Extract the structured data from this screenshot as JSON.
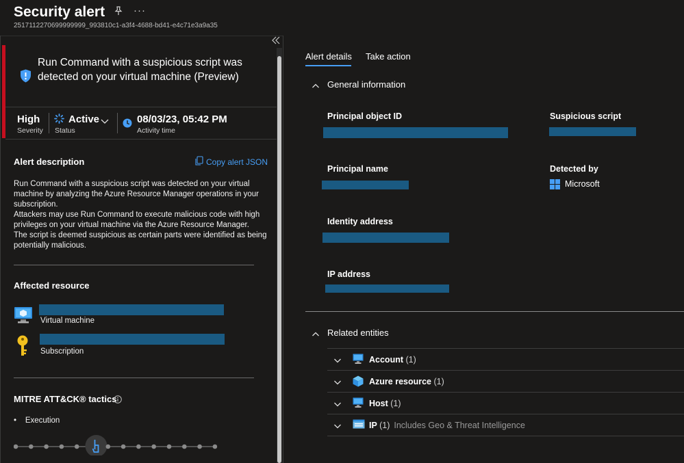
{
  "header": {
    "title": "Security alert",
    "alert_id": "2517112270699999999_993810c1-a3f4-4688-bd41-e4c71e3a9a35",
    "more_label": "···"
  },
  "alert": {
    "name": "Run Command with a suspicious script was detected on your virtual machine (Preview)",
    "severity_value": "High",
    "severity_label": "Severity",
    "status_value": "Active",
    "status_label": "Status",
    "activity_value": "08/03/23, 05:42 PM",
    "activity_label": "Activity time"
  },
  "description": {
    "title": "Alert description",
    "copy_label": "Copy alert JSON",
    "lines": [
      "Run Command with a suspicious script was detected on your virtual machine by analyzing the Azure Resource Manager operations in your subscription.",
      "Attackers may use Run Command to execute malicious code with high privileges on your virtual machine via the Azure Resource Manager.",
      "The script is deemed suspicious as certain parts were identified as being potentially malicious."
    ]
  },
  "affected": {
    "title": "Affected resource",
    "vm_label": "Virtual machine",
    "sub_label": "Subscription"
  },
  "mitre": {
    "title": "MITRE ATT&CK® tactics",
    "tactics": [
      "Execution"
    ],
    "kill_chain_active_index": 5
  },
  "tabs": {
    "details": "Alert details",
    "action": "Take action"
  },
  "general": {
    "title": "General information",
    "principal_object_id": "Principal object ID",
    "suspicious_script": "Suspicious script",
    "principal_name": "Principal name",
    "detected_by": "Detected by",
    "detected_by_value": "Microsoft",
    "identity_address": "Identity address",
    "ip_address": "IP address"
  },
  "related": {
    "title": "Related entities",
    "entities": [
      {
        "name": "Account",
        "count": "(1)",
        "note": "",
        "icon": "monitor-icon"
      },
      {
        "name": "Azure resource",
        "count": "(1)",
        "note": "",
        "icon": "cube-icon"
      },
      {
        "name": "Host",
        "count": "(1)",
        "note": "",
        "icon": "monitor-icon"
      },
      {
        "name": "IP",
        "count": "(1)",
        "note": "Includes Geo & Threat Intelligence",
        "icon": "ip-icon"
      }
    ]
  },
  "colors": {
    "accent": "#479ef5",
    "severity_bar": "#c50f1f",
    "redaction": "#1a5a82"
  }
}
